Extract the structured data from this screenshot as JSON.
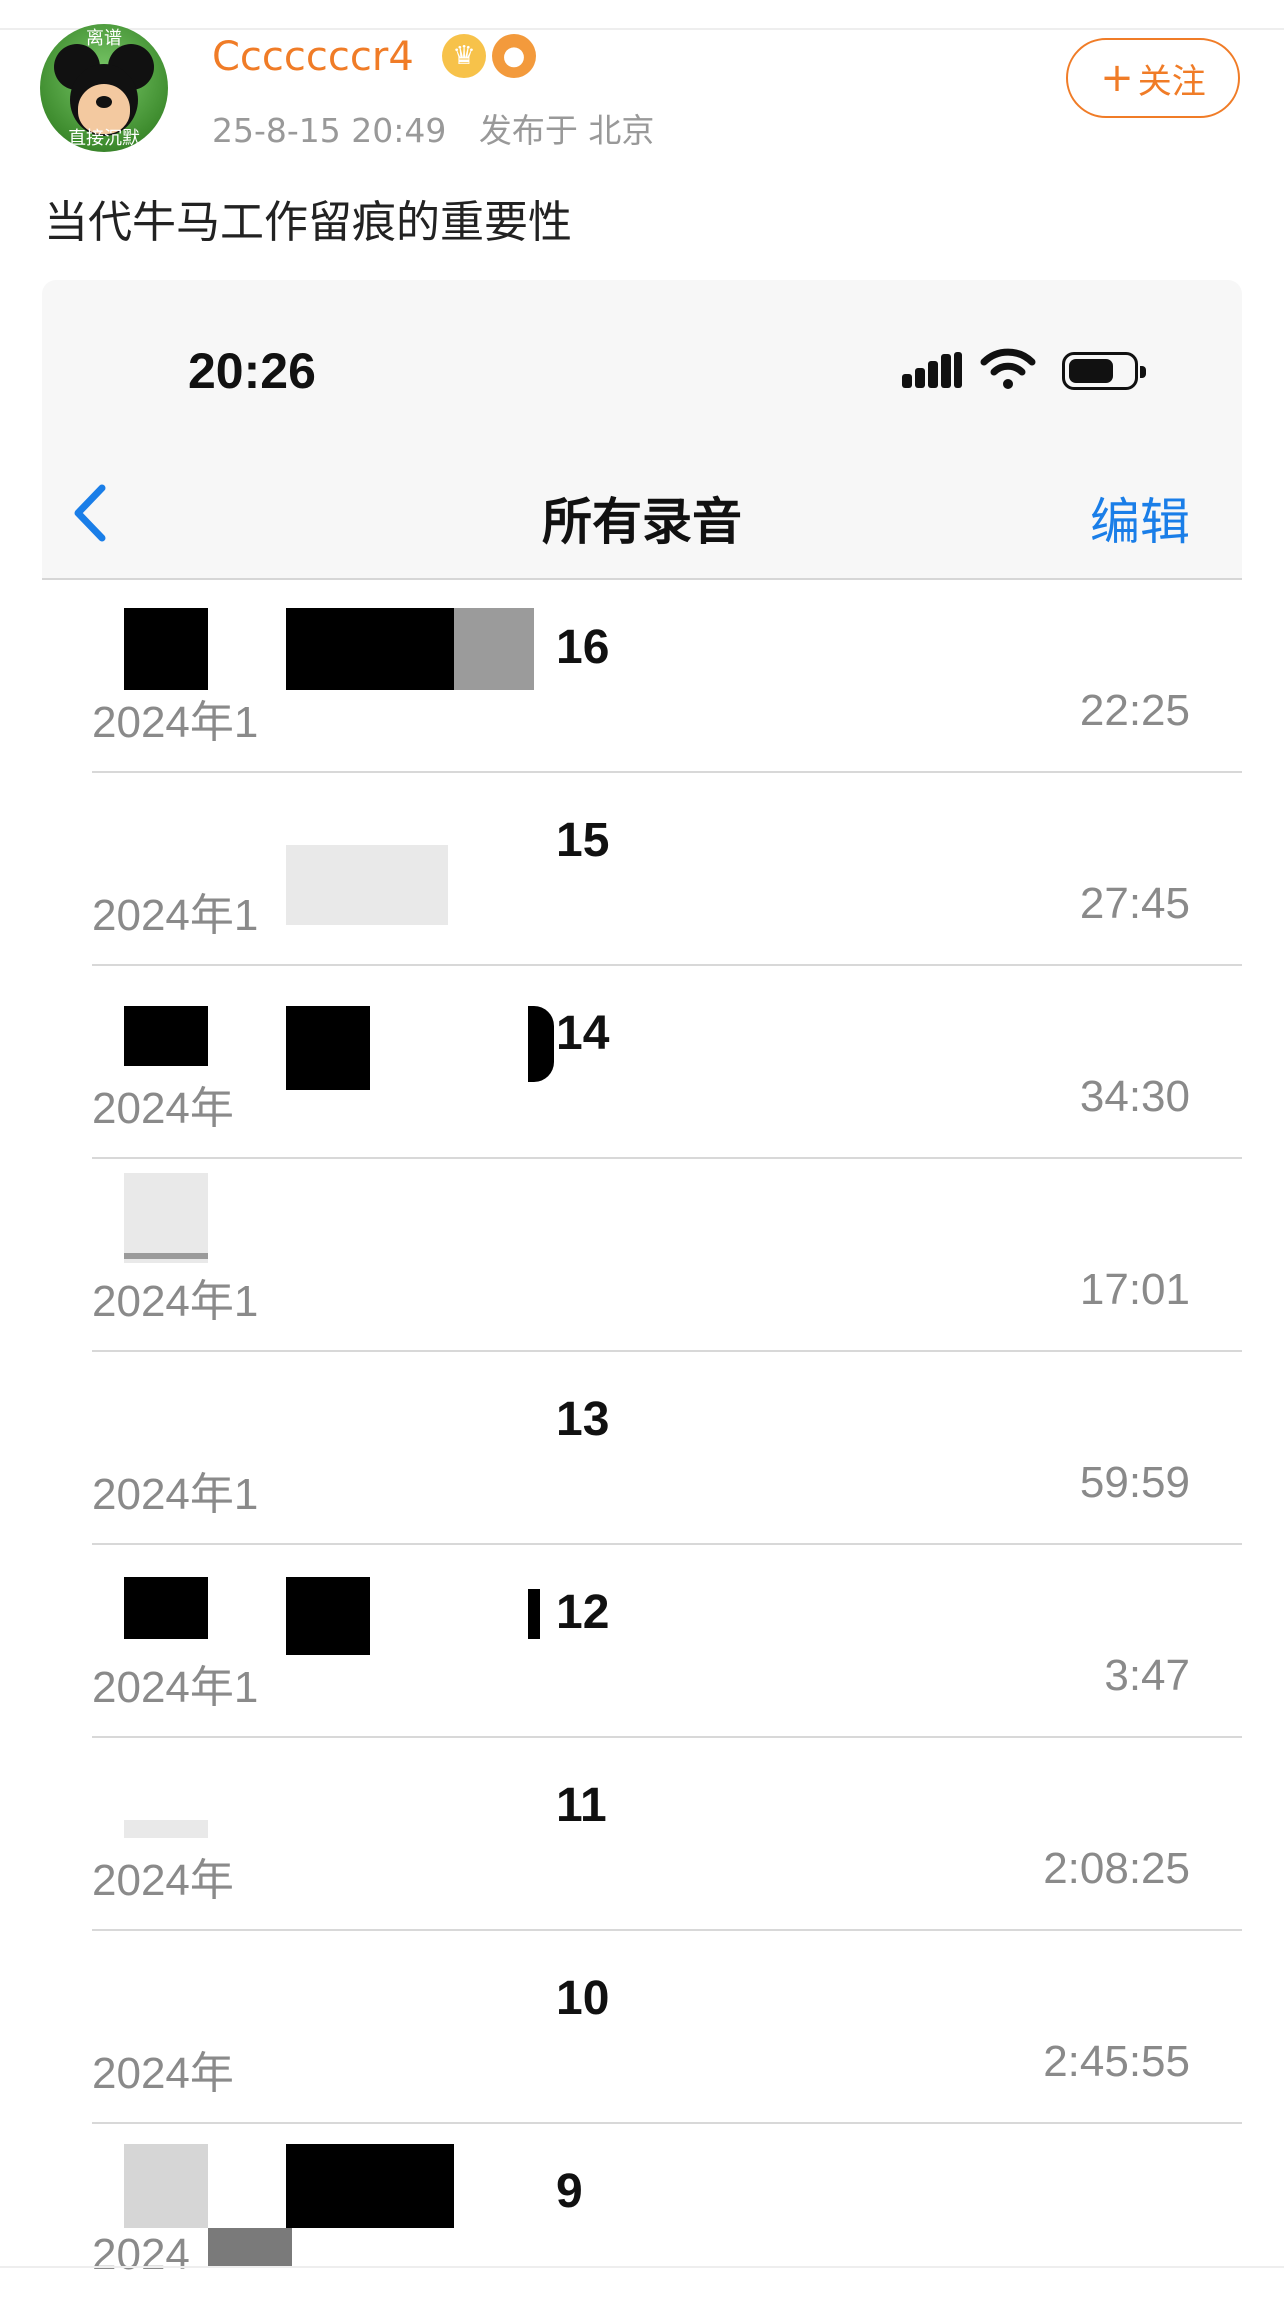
{
  "post": {
    "username": "Cccccccr4",
    "timestamp": "25-8-15 20:49",
    "location": "发布于 北京",
    "follow_label": "关注",
    "follow_plus": "+",
    "text": "当代牛马工作留痕的重要性",
    "avatar_top_text": "离谱",
    "avatar_bottom_text": "直接沉默",
    "badges": [
      "crown-badge-icon",
      "fish-badge-icon"
    ],
    "colors": {
      "accent": "#f07c27",
      "ios_blue": "#1a7ee8"
    }
  },
  "screenshot": {
    "status_time": "20:26",
    "nav_title": "所有录音",
    "edit_label": "编辑",
    "recordings": [
      {
        "title": "16",
        "date": "2024年1",
        "duration": "22:25"
      },
      {
        "title": "15",
        "date": "2024年1",
        "duration": "27:45"
      },
      {
        "title": "14",
        "date": "2024年",
        "duration": "34:30"
      },
      {
        "title": "",
        "date": "2024年1",
        "duration": "17:01"
      },
      {
        "title": "13",
        "date": "2024年1",
        "duration": "59:59"
      },
      {
        "title": "12",
        "date": "2024年1",
        "duration": "3:47"
      },
      {
        "title": "11",
        "date": "2024年",
        "duration": "2:08:25"
      },
      {
        "title": "10",
        "date": "2024年",
        "duration": "2:45:55"
      },
      {
        "title": "9",
        "date": "2024",
        "duration": ""
      }
    ]
  }
}
